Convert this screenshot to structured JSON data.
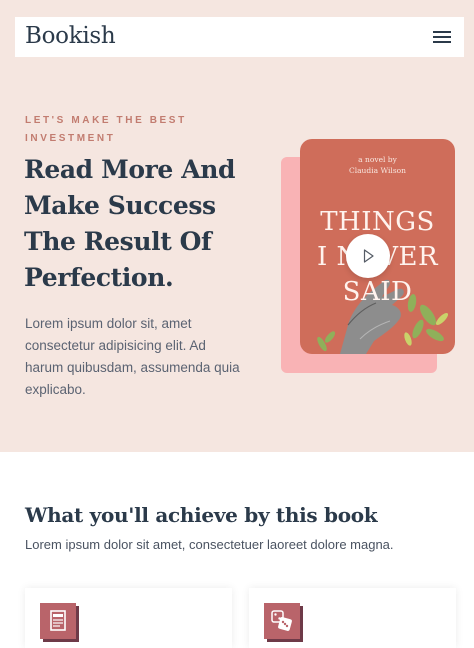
{
  "header": {
    "brand": "Bookish",
    "menu_icon": "hamburger-menu-icon"
  },
  "hero": {
    "eyebrow": "LET'S MAKE THE BEST INVESTMENT",
    "headline": "Read More And Make Success The Result Of Perfection.",
    "lead": "Lorem ipsum dolor sit, amet consectetur adipisicing elit. Ad harum quibusdam, assumenda quia explicabo."
  },
  "book": {
    "byline_top": "a novel by",
    "byline_author": "Claudia Wilson",
    "title_line1": "THINGS",
    "title_line2": "I NEVER",
    "title_line3": "SAID",
    "play_icon": "play-icon"
  },
  "achieve": {
    "title": "What you'll achieve by this book",
    "lead": "Lorem ipsum dolor sit amet, consectetuer laoreet dolore magna."
  },
  "features": [
    {
      "icon": "document-icon"
    },
    {
      "icon": "dice-icon"
    }
  ],
  "colors": {
    "hero_bg": "#f5e6e0",
    "navy": "#2b3a4a",
    "accent": "#c27c70",
    "cover": "#cf6d5a",
    "cover_shadow": "#f9b3b5",
    "icon_bg": "#b9646a"
  }
}
